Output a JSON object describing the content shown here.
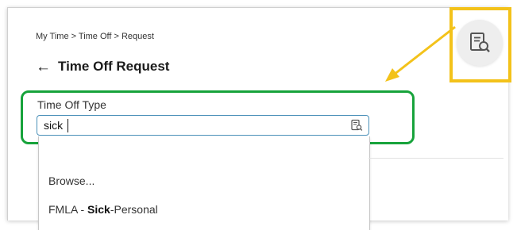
{
  "breadcrumb": {
    "items": [
      "My Time",
      "Time Off",
      "Request"
    ],
    "separator": ">",
    "text": "My Time > Time Off > Request"
  },
  "header": {
    "back_icon": "arrow-left-icon",
    "title": "Time Off Request"
  },
  "field": {
    "label": "Time Off Type",
    "value": "sick",
    "icon": "search-list-icon"
  },
  "dropdown": {
    "browse_label": "Browse...",
    "match_prefix": "FMLA - ",
    "match_highlight": "Sick",
    "match_suffix": "-Personal"
  },
  "annotations": {
    "callout_icon": "search-list-icon",
    "highlight_color": "#17a33b",
    "callout_color": "#f3c21a"
  }
}
